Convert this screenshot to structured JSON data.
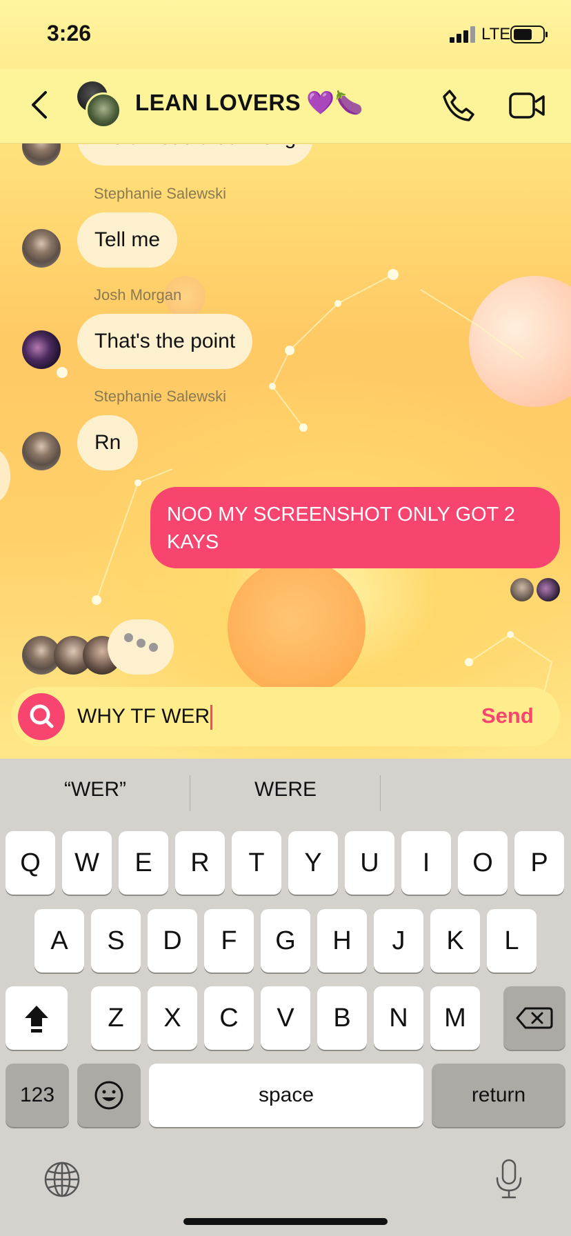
{
  "status_bar": {
    "time": "3:26",
    "network": "LTE"
  },
  "header": {
    "title": "LEAN LOVERS",
    "title_emoji": "💜🍆"
  },
  "messages": {
    "partial_text": "Wait I read that wrong",
    "m1": {
      "sender": "Stephanie Salewski",
      "text": "Tell me"
    },
    "m2": {
      "sender": "Josh Morgan",
      "text": "That's the point"
    },
    "m3": {
      "sender": "Stephanie Salewski",
      "text": "Rn"
    },
    "outgoing": {
      "text": "NOO MY SCREENSHOT ONLY GOT 2 KAYS"
    }
  },
  "composer": {
    "value": "WHY TF WER",
    "send_label": "Send"
  },
  "keyboard": {
    "suggestions": [
      "“WER”",
      "WERE",
      ""
    ],
    "row1": [
      "Q",
      "W",
      "E",
      "R",
      "T",
      "Y",
      "U",
      "I",
      "O",
      "P"
    ],
    "row2": [
      "A",
      "S",
      "D",
      "F",
      "G",
      "H",
      "J",
      "K",
      "L"
    ],
    "row3": [
      "Z",
      "X",
      "C",
      "V",
      "B",
      "N",
      "M"
    ],
    "numbers_label": "123",
    "space_label": "space",
    "return_label": "return"
  },
  "colors": {
    "accent": "#f7456f",
    "header_bg": "#fdf49a",
    "bubble_in": "#fcf0cf"
  },
  "icons": [
    "back-arrow-icon",
    "phone-icon",
    "video-camera-icon",
    "search-icon",
    "shift-icon",
    "backspace-icon",
    "emoji-icon",
    "globe-icon",
    "microphone-icon"
  ]
}
